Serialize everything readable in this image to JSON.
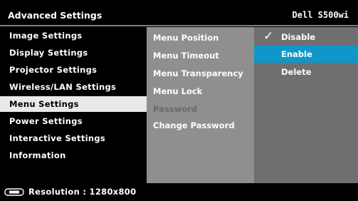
{
  "header": {
    "title": "Advanced Settings",
    "model": "Dell S500wi"
  },
  "left_menu": {
    "items": [
      {
        "label": "Image Settings"
      },
      {
        "label": "Display Settings"
      },
      {
        "label": "Projector Settings"
      },
      {
        "label": "Wireless/LAN Settings"
      },
      {
        "label": "Menu Settings"
      },
      {
        "label": "Power Settings"
      },
      {
        "label": "Interactive Settings"
      },
      {
        "label": "Information"
      }
    ],
    "active": "Menu Settings"
  },
  "submenu": {
    "items": [
      {
        "label": "Menu Position"
      },
      {
        "label": "Menu Timeout"
      },
      {
        "label": "Menu Transparency"
      },
      {
        "label": "Menu Lock"
      },
      {
        "label": "Password"
      },
      {
        "label": "Change Password"
      }
    ],
    "disabled": "Password"
  },
  "options": {
    "items": [
      {
        "label": "Disable",
        "checked": true
      },
      {
        "label": "Enable"
      },
      {
        "label": "Delete"
      }
    ],
    "selected": "Enable",
    "check_mark": "✓",
    "highlight_color": "#0f97c9"
  },
  "footer": {
    "icon": "projector-source-icon",
    "resolution": "Resolution : 1280x800"
  }
}
